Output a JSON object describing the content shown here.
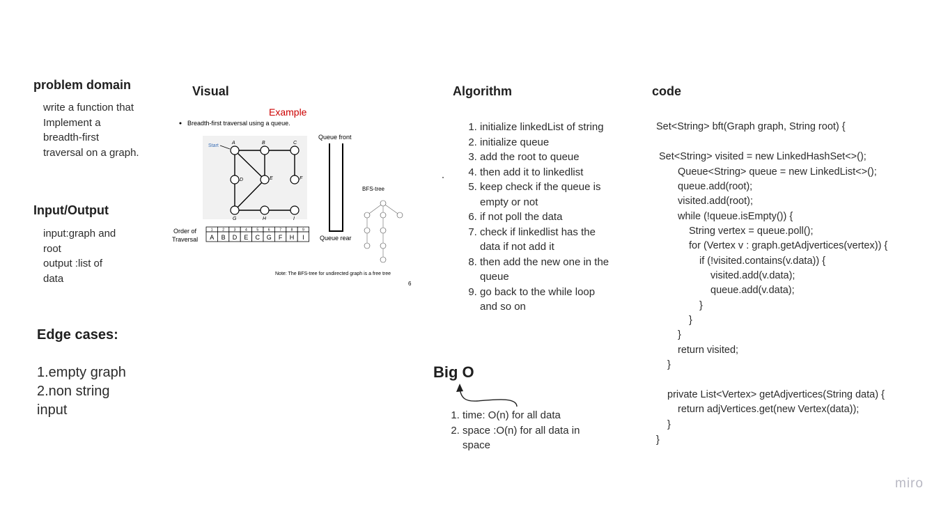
{
  "problem_domain": {
    "title": "problem domain",
    "lines": [
      "write a function that",
      "Implement a",
      "breadth-first",
      "traversal on a graph."
    ]
  },
  "input_output": {
    "title": "Input/Output",
    "lines": [
      "input:graph and",
      "root",
      "output :list of",
      "data"
    ]
  },
  "edge_cases": {
    "title": "Edge cases:",
    "lines": [
      "1.empty graph",
      "2.non string",
      "input"
    ]
  },
  "visual": {
    "title": "Visual",
    "slide": {
      "example": "Example",
      "bullet": "Breadth-first traversal using a queue.",
      "start": "Start",
      "queue_front": "Queue front",
      "queue_rear": "Queue rear",
      "bfs_tree": "BFS-tree",
      "order_label_1": "Order of",
      "order_label_2": "Traversal",
      "order_numbers": [
        "1",
        "2",
        "3",
        "4",
        "5",
        "6",
        "7",
        "8",
        "9"
      ],
      "order_values": [
        "A",
        "B",
        "D",
        "E",
        "C",
        "G",
        "F",
        "H",
        "I"
      ],
      "node_labels": [
        "A",
        "B",
        "C",
        "D",
        "E",
        "F",
        "G",
        "H",
        "I"
      ],
      "note": "Note: The BFS-tree for undirected graph is a free tree",
      "page_number": "6"
    }
  },
  "algorithm": {
    "title": "Algorithm",
    "steps": [
      "initialize linkedList of string",
      "initialize queue",
      "add the root to queue",
      "then add it to linkedlist",
      "keep check if the queue is empty or not",
      "if not poll the data",
      "check if linkedlist has the data if not add it",
      "then add the new one in the queue",
      "go back to the while loop and so on"
    ]
  },
  "big_o": {
    "title": "Big O",
    "items": [
      "time: O(n) for all data",
      "space :O(n) for all data in space"
    ]
  },
  "code": {
    "title": "code",
    "lines": [
      "Set<String> bft(Graph graph, String root) {",
      "Set<String> visited = new LinkedHashSet<>();",
      "Queue<String> queue = new LinkedList<>();",
      "queue.add(root);",
      "visited.add(root);",
      "while (!queue.isEmpty()) {",
      "String vertex = queue.poll();",
      "for (Vertex v : graph.getAdjvertices(vertex)) {",
      "if (!visited.contains(v.data)) {",
      "visited.add(v.data);",
      "queue.add(v.data);",
      "}",
      "}",
      "}",
      "return visited;",
      "}",
      "private List<Vertex> getAdjvertices(String data) {",
      "return adjVertices.get(new Vertex(data));",
      "}",
      "}"
    ]
  },
  "brand": {
    "logo_text": "miro"
  },
  "colors": {
    "example_red": "#cc0000",
    "start_blue": "#3b6fb6"
  }
}
